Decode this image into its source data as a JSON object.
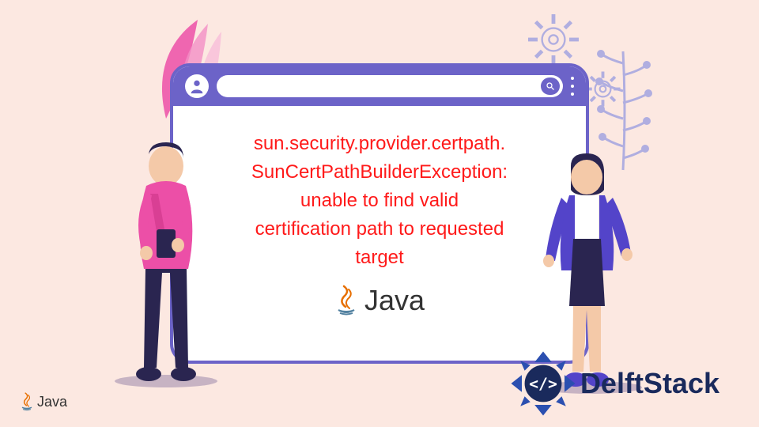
{
  "error": {
    "line1": "sun.security.provider.certpath.",
    "line2": "SunCertPathBuilderException:",
    "line3": "unable to find valid",
    "line4": "certification path to requested",
    "line5": "target"
  },
  "javaLogo": {
    "label": "Java"
  },
  "javaLogoSmall": {
    "label": "Java"
  },
  "delftStack": {
    "label": "DelftStack"
  },
  "colors": {
    "background": "#fce8e1",
    "browserBorder": "#6c63c8",
    "errorText": "#ff1a1a",
    "delftBlue": "#1a2a5c",
    "pink": "#ec4fa7",
    "lightPurple": "#b0aee0"
  }
}
